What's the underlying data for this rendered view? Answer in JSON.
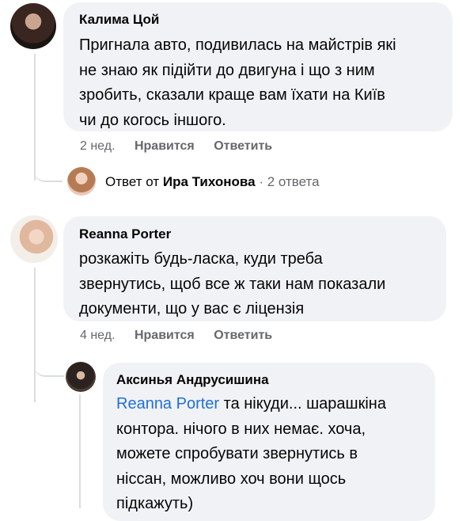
{
  "comments": [
    {
      "author": "Калима Цой",
      "lines": [
        "Пригнала авто, подивилась на майстрів які",
        "не знаю як підійти до двигуна і що з ним",
        "зробить, сказали краще вам їхати на Київ",
        "чи до когось іншого."
      ],
      "time": "2 нед.",
      "like_label": "Нравится",
      "reply_label": "Ответить"
    },
    {
      "author": "Reanna Porter",
      "lines": [
        "розкажіть будь-ласка, куди треба",
        "звернутись, щоб все ж таки нам показали",
        "документи, що у вас є ліцензія"
      ],
      "time": "4 нед.",
      "like_label": "Нравится",
      "reply_label": "Ответить"
    }
  ],
  "reply_summary": {
    "prefix": "Ответ от",
    "author": "Ира Тихонова",
    "count": "· 2 ответа"
  },
  "reply": {
    "author": "Аксинья Андрусишина",
    "mention": "Reanna Porter",
    "line1_rest": " та нікуди... шарашкіна",
    "lines": [
      "контора. нічого в них немає. хоча,",
      "можете спробувати звернутись в",
      "ніссан, можливо хоч вони щось",
      "підкажуть)"
    ]
  },
  "colors": {
    "bubble": "#f0f2f5",
    "meta_text": "#65676b",
    "mention_link": "#216fdb",
    "thread_line": "#dadde1"
  }
}
